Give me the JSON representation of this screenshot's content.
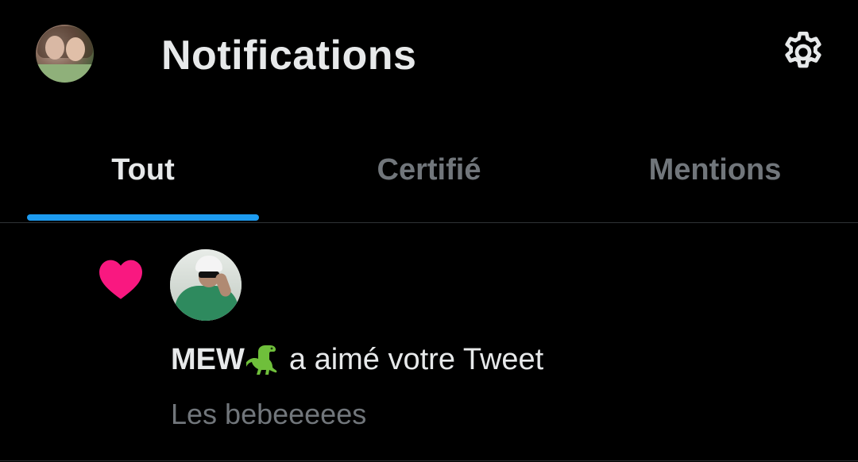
{
  "header": {
    "title": "Notifications",
    "avatar_icon": "profile-avatar",
    "settings_icon": "gear-icon"
  },
  "tabs": [
    {
      "label": "Tout",
      "active": true
    },
    {
      "label": "Certifié",
      "active": false
    },
    {
      "label": "Mentions",
      "active": false
    }
  ],
  "notification": {
    "type_icon": "heart-icon",
    "user": "MEW",
    "emoji": "dinosaur",
    "action": "a aimé votre Tweet",
    "tweet_text": "Les bebeeeees"
  },
  "colors": {
    "background": "#000000",
    "text_primary": "#e7e9ea",
    "text_secondary": "#71767b",
    "accent": "#1d9bf0",
    "heart": "#f91880",
    "divider": "#2f3336"
  }
}
